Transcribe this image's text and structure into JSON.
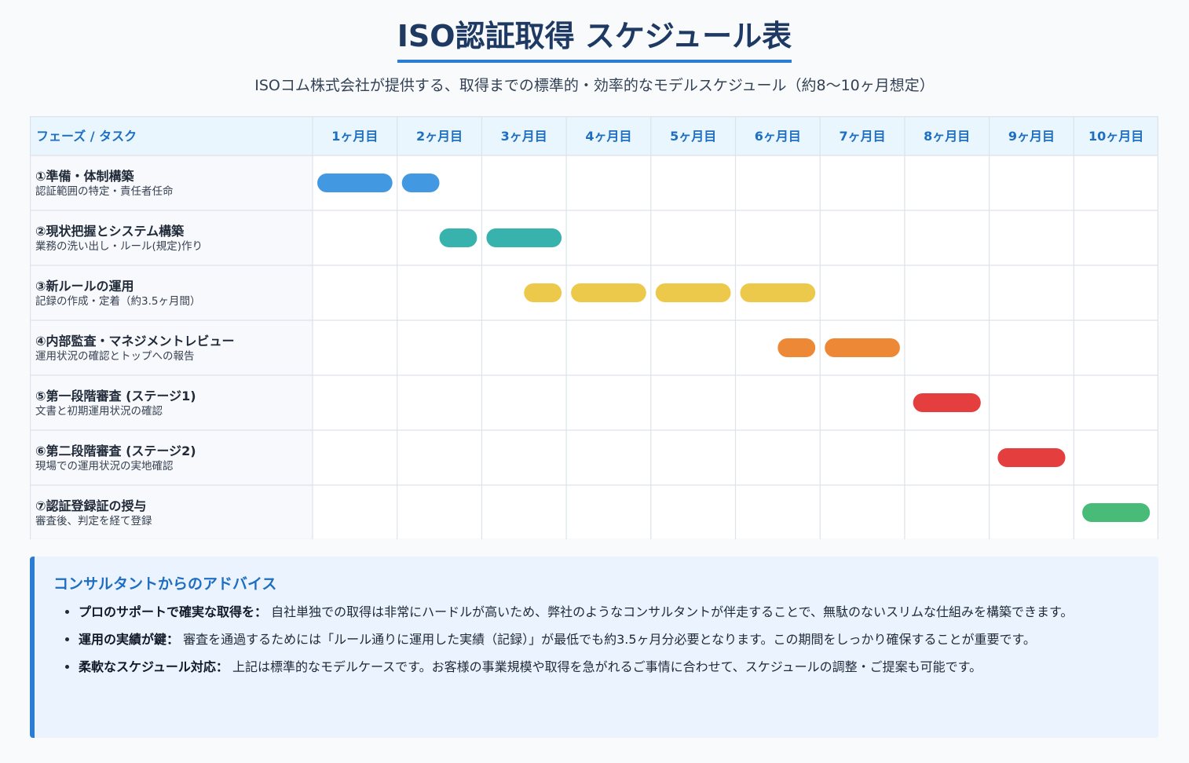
{
  "page": {
    "title": "ISO認証取得 スケジュール表",
    "subtitle": "ISOコム株式会社が提供する、取得までの標準的・効率的なモデルスケジュール（約8〜10ヶ月想定）"
  },
  "chart_data": {
    "type": "gantt",
    "header_label": "フェーズ / タスク",
    "months": [
      "1ヶ月目",
      "2ヶ月目",
      "3ヶ月目",
      "4ヶ月目",
      "5ヶ月目",
      "6ヶ月目",
      "7ヶ月目",
      "8ヶ月目",
      "9ヶ月目",
      "10ヶ月目"
    ],
    "tasks": [
      {
        "name": "①準備・体制構築",
        "desc": "認証範囲の特定・責任者任命",
        "start": 0,
        "end": 1.5,
        "color": "#4299e1"
      },
      {
        "name": "②現状把握とシステム構築",
        "desc": "業務の洗い出し・ルール(規定)作り",
        "start": 1.5,
        "end": 3,
        "color": "#38b2ac"
      },
      {
        "name": "③新ルールの運用",
        "desc": "記録の作成・定着（約3.5ヶ月間）",
        "start": 2.5,
        "end": 6,
        "color": "#ecc94b"
      },
      {
        "name": "④内部監査・マネジメントレビュー",
        "desc": "運用状況の確認とトップへの報告",
        "start": 5.5,
        "end": 7,
        "color": "#ed8936"
      },
      {
        "name": "⑤第一段階審査 (ステージ1)",
        "desc": "文書と初期運用状況の確認",
        "start": 7.1,
        "end": 7.9,
        "color": "#e53e3e"
      },
      {
        "name": "⑥第二段階審査 (ステージ2)",
        "desc": "現場での運用状況の実地確認",
        "start": 8.1,
        "end": 8.9,
        "color": "#e53e3e"
      },
      {
        "name": "⑦認証登録証の授与",
        "desc": "審査後、判定を経て登録",
        "start": 9.1,
        "end": 9.9,
        "color": "#48bb78"
      }
    ]
  },
  "advice": {
    "title": "コンサルタントからのアドバイス",
    "items": [
      {
        "head": "プロのサポートで確実な取得を：",
        "body": "自社単独での取得は非常にハードルが高いため、弊社のようなコンサルタントが伴走することで、無駄のないスリムな仕組みを構築できます。"
      },
      {
        "head": "運用の実績が鍵：",
        "body": "審査を通過するためには「ルール通りに運用した実績（記録）」が最低でも約3.5ヶ月分必要となります。この期間をしっかり確保することが重要です。"
      },
      {
        "head": "柔軟なスケジュール対応：",
        "body": "上記は標準的なモデルケースです。お客様の事業規模や取得を急がれるご事情に合わせて、スケジュールの調整・ご提案も可能です。"
      }
    ]
  }
}
